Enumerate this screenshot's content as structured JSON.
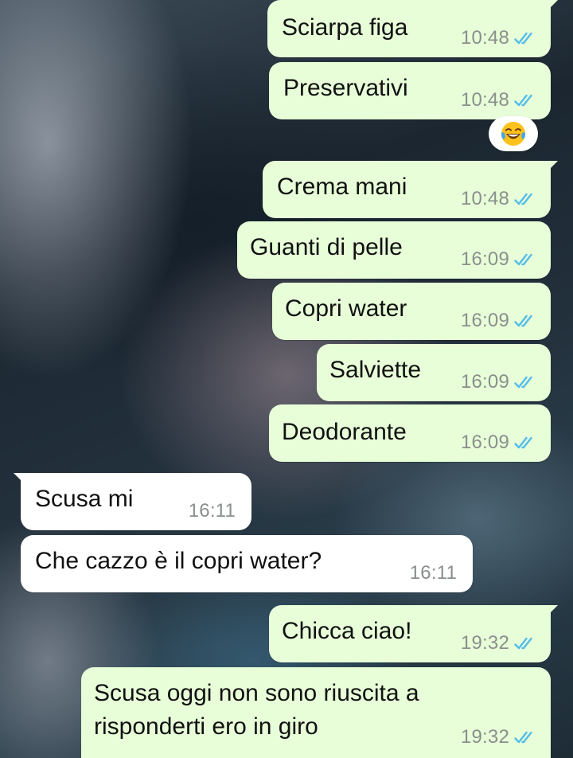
{
  "messages": [
    {
      "text": "Sciarpa figa",
      "time": "10:48",
      "direction": "out",
      "status": "read"
    },
    {
      "text": "Preservativi",
      "time": "10:48",
      "direction": "out",
      "status": "read",
      "reaction": "😂"
    },
    {
      "text": "Crema mani",
      "time": "10:48",
      "direction": "out",
      "status": "read"
    },
    {
      "text": "Guanti di pelle",
      "time": "16:09",
      "direction": "out",
      "status": "read"
    },
    {
      "text": "Copri water",
      "time": "16:09",
      "direction": "out",
      "status": "read"
    },
    {
      "text": "Salviette",
      "time": "16:09",
      "direction": "out",
      "status": "read"
    },
    {
      "text": "Deodorante",
      "time": "16:09",
      "direction": "out",
      "status": "read"
    },
    {
      "text": "Scusa mi",
      "time": "16:11",
      "direction": "in"
    },
    {
      "text": "Che cazzo è il copri water?",
      "time": "16:11",
      "direction": "in"
    },
    {
      "text": "Chicca ciao!",
      "time": "19:32",
      "direction": "out",
      "status": "read"
    },
    {
      "text_line1": "Scusa oggi non sono riuscita a",
      "text_line2": "risponderti ero in giro",
      "time": "19:32",
      "direction": "out",
      "status": "read"
    }
  ],
  "colors": {
    "outgoing_bubble": "#e7fed8",
    "incoming_bubble": "#ffffff",
    "read_ticks": "#53bdeb",
    "timestamp": "#8a8f8c"
  },
  "icons": {
    "read_status": "double-check-icon",
    "reaction": "face-with-tears-of-joy-emoji"
  }
}
